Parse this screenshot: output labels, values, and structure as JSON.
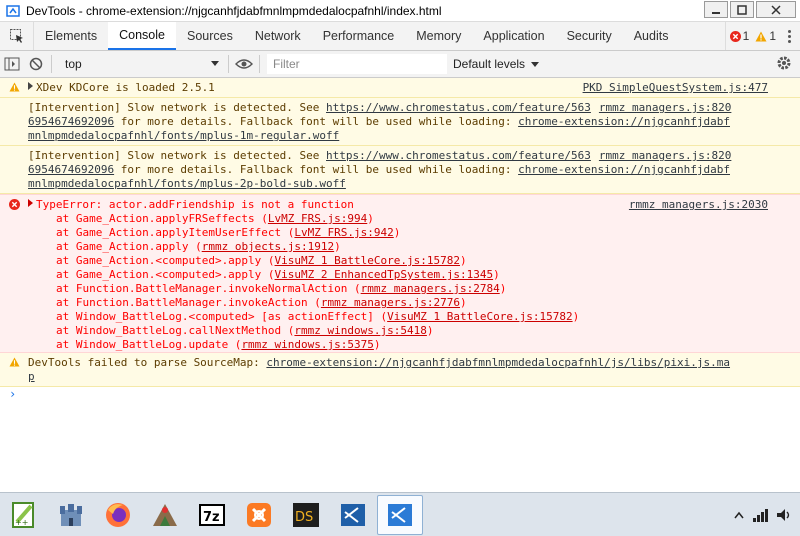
{
  "window": {
    "title": "DevTools - chrome-extension://njgcanhfjdabfmnlmpmdedalocpafnhl/index.html"
  },
  "tabs": [
    "Elements",
    "Console",
    "Sources",
    "Network",
    "Performance",
    "Memory",
    "Application",
    "Security",
    "Audits"
  ],
  "active_tab": "Console",
  "badges": {
    "errors": "1",
    "warnings": "1"
  },
  "toolbar": {
    "context": "top",
    "filter_placeholder": "Filter",
    "levels": "Default levels"
  },
  "messages": {
    "m1": {
      "text": "XDev KDCore is loaded 2.5.1",
      "source": "PKD SimpleQuestSystem.js:477"
    },
    "m2": {
      "prefix": "[Intervention] Slow network is detected. See ",
      "url": "https://www.chromestatus.com/feature/5636954674692096",
      "url_a": "https://www.chromestatus.com/feature/563",
      "url_b": "6954674692096",
      "mid": " for more details. Fallback font will be used while loading: ",
      "font_a": "chrome-extension://njgcanhfjdabf",
      "font_b": "mnlmpmdedalocpafnhl/fonts/mplus-1m-regular.woff",
      "source": "rmmz managers.js:820"
    },
    "m3": {
      "prefix": "[Intervention] Slow network is detected. See ",
      "url_a": "https://www.chromestatus.com/feature/563",
      "url_b": "6954674692096",
      "mid": " for more details. Fallback font will be used while loading: ",
      "font_a": "chrome-extension://njgcanhfjdabf",
      "font_b": "mnlmpmdedalocpafnhl/fonts/mplus-2p-bold-sub.woff",
      "source": "rmmz managers.js:820"
    },
    "err": {
      "text": "TypeError: actor.addFriendship is not a function",
      "source": "rmmz managers.js:2030",
      "stack": [
        {
          "fn": "at Game_Action.applyFRSeffects (",
          "loc": "LvMZ FRS.js:994",
          "end": ")"
        },
        {
          "fn": "at Game_Action.applyItemUserEffect (",
          "loc": "LvMZ FRS.js:942",
          "end": ")"
        },
        {
          "fn": "at Game_Action.apply (",
          "loc": "rmmz objects.js:1912",
          "end": ")"
        },
        {
          "fn": "at Game_Action.<computed>.apply (",
          "loc": "VisuMZ 1 BattleCore.js:15782",
          "end": ")"
        },
        {
          "fn": "at Game_Action.<computed>.apply (",
          "loc": "VisuMZ 2 EnhancedTpSystem.js:1345",
          "end": ")"
        },
        {
          "fn": "at Function.BattleManager.invokeNormalAction (",
          "loc": "rmmz managers.js:2784",
          "end": ")"
        },
        {
          "fn": "at Function.BattleManager.invokeAction (",
          "loc": "rmmz managers.js:2776",
          "end": ")"
        },
        {
          "fn": "at Window_BattleLog.<computed> [as actionEffect] (",
          "loc": "VisuMZ 1 BattleCore.js:15782",
          "end": ")"
        },
        {
          "fn": "at Window_BattleLog.callNextMethod (",
          "loc": "rmmz windows.js:5418",
          "end": ")"
        },
        {
          "fn": "at Window_BattleLog.update (",
          "loc": "rmmz windows.js:5375",
          "end": ")"
        }
      ]
    },
    "m5": {
      "prefix": "DevTools failed to parse SourceMap: ",
      "url_a": "chrome-extension://njgcanhfjdabfmnlmpmdedalocpafnhl/js/libs/pixi.js.ma",
      "url_b": "p"
    }
  },
  "prompt": "›",
  "colors": {
    "accent": "#1a73e8",
    "error": "#ff0000",
    "warning_bg": "#fffbe5",
    "error_bg": "#fff0f0"
  }
}
